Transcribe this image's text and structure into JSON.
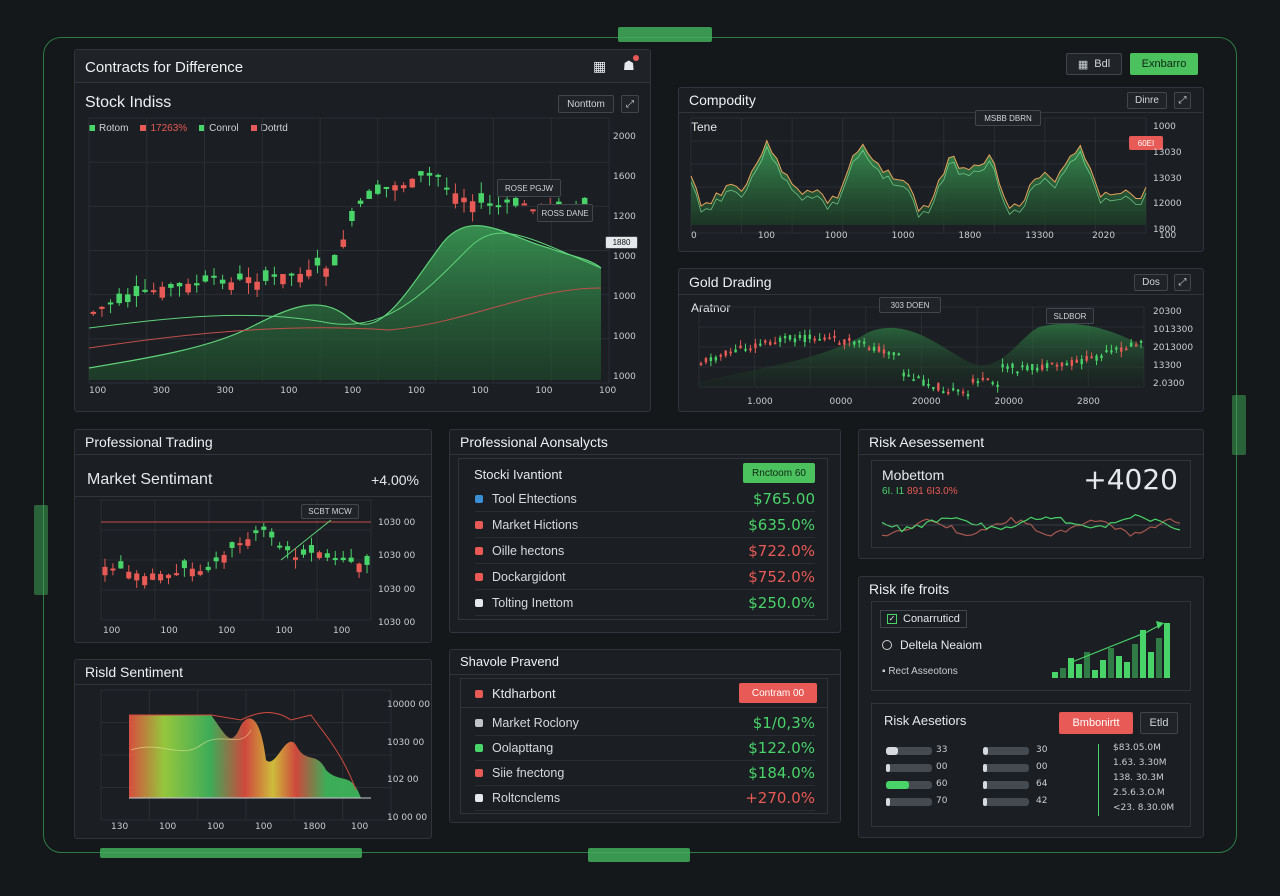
{
  "frame": {
    "accent": "#3fae5a",
    "up": "#49d46a",
    "down": "#e85a55"
  },
  "topright": {
    "btn1": "Bdl",
    "btn2": "Exnbarro"
  },
  "stock_panel": {
    "title": "Contracts for Difference",
    "subtitle": "Stock Indiss",
    "control_label": "Nonttom",
    "legend": [
      {
        "label": "Rotom",
        "color": "#49d46a"
      },
      {
        "label": "17263%",
        "color": "#e85a55"
      },
      {
        "label": "Conrol",
        "color": "#49d46a"
      },
      {
        "label": "Dotrtd",
        "color": "#e85a55"
      }
    ],
    "tag1": "ROSE PGJW",
    "tag2": "ROSS DANE",
    "price_tag": "1880",
    "y_ticks": [
      "2000",
      "1600",
      "1200",
      "1000",
      "1000",
      "1000",
      "1000"
    ],
    "x_ticks": [
      "100",
      "300",
      "300",
      "100",
      "100",
      "100",
      "100",
      "100",
      "100"
    ]
  },
  "commodity_panel": {
    "title": "Compodity",
    "label": "Tene",
    "control_label": "Dinre",
    "tag": "MSBB DBRN",
    "price_tag": "60EI",
    "y_ticks": [
      "1000",
      "13030",
      "13030",
      "12000",
      "1800"
    ],
    "x_ticks": [
      "0",
      "100",
      "1000",
      "1000",
      "1800",
      "13300",
      "2020",
      "100"
    ]
  },
  "gold_panel": {
    "title": "Gold Drading",
    "label": "Aratnor",
    "control_label": "Dos",
    "tag1": "303 DOEN",
    "tag2": "SLDBOR",
    "y_ticks": [
      "20300",
      "1013300",
      "2013000",
      "13300",
      "2.0300"
    ],
    "x_ticks": [
      "1.000",
      "0000",
      "20000",
      "20000",
      "2800"
    ]
  },
  "pro_trading": {
    "title": "Professional Trading",
    "sentiment_label": "Market Sentimant",
    "sentiment_value": "+4.00%",
    "tag": "SCBT MCW",
    "y_ticks": [
      "1030 00",
      "1030 00",
      "1030 00",
      "1030 00"
    ],
    "x_ticks": [
      "100",
      "100",
      "100",
      "100",
      "100"
    ]
  },
  "risk_sentiment": {
    "title": "Risld Sentiment",
    "y_ticks": [
      "10000 00",
      "1030 00",
      "102 00",
      "10 00 00"
    ],
    "x_ticks": [
      "130",
      "100",
      "100",
      "100",
      "1800",
      "100"
    ]
  },
  "pro_assets": {
    "title": "Professional Aonsalycts",
    "header_label": "Stocki Ivantiont",
    "header_button": "Rnctoom 60",
    "rows": [
      {
        "label": "Tool Ehtections",
        "value": "$765.00",
        "trend": "up",
        "icon_color": "#3a8fd6"
      },
      {
        "label": "Market Hictions",
        "value": "$635.0%",
        "trend": "up",
        "icon_color": "#e85a55"
      },
      {
        "label": "Oille hectons",
        "value": "$722.0%",
        "trend": "down",
        "icon_color": "#e85a55"
      },
      {
        "label": "Dockargidont",
        "value": "$752.0%",
        "trend": "down",
        "icon_color": "#e85a55"
      },
      {
        "label": "Tolting Inettom",
        "value": "$250.0%",
        "trend": "up",
        "icon_color": "#e6e9ec"
      }
    ]
  },
  "shavole_panel": {
    "title": "Shavole Pravend",
    "header_label": "Ktdharbont",
    "header_button": "Contram 00",
    "rows": [
      {
        "label": "Market Roclony",
        "value": "$1/0,3%",
        "trend": "up",
        "icon_color": "#c0c4c8"
      },
      {
        "label": "Oolapttang",
        "value": "$122.0%",
        "trend": "up",
        "icon_color": "#49d46a"
      },
      {
        "label": "Siie fnectong",
        "value": "$184.0%",
        "trend": "up",
        "icon_color": "#e85a55"
      },
      {
        "label": "Roltcnclems",
        "value": "+270.0%",
        "trend": "down",
        "icon_color": "#e6e9ec"
      }
    ]
  },
  "risk_assessment": {
    "title": "Risk Aesessement",
    "label": "Mobettom",
    "value": "+4020",
    "sub_green": "6I. I1",
    "sub_red": "891 6I3.0%"
  },
  "risk_profits": {
    "title": "Risk ife froits",
    "item1": "Conarruticd",
    "item2": "Deltela Neaiom",
    "item3": "Rect Asseotons"
  },
  "risk_assessors": {
    "title": "Risk Aesetiors",
    "btn_primary": "Bmbonirtt",
    "btn_secondary": "Etld",
    "bars_left": [
      {
        "fraction": 0.25,
        "value": "33",
        "color": "#8a9097"
      },
      {
        "fraction": 0,
        "value": "00",
        "color": "#8a9097"
      },
      {
        "fraction": 0.5,
        "value": "60",
        "color": "#49d46a"
      },
      {
        "fraction": 0,
        "value": "70",
        "color": "#8a9097"
      }
    ],
    "bars_right": [
      {
        "fraction": 0.1,
        "value": "30",
        "color": "#8a9097"
      },
      {
        "fraction": 0.05,
        "value": "00",
        "color": "#8a9097"
      },
      {
        "fraction": 0,
        "value": "64",
        "color": "#8a9097"
      },
      {
        "fraction": 0,
        "value": "42",
        "color": "#8a9097"
      }
    ],
    "values_list": [
      "$83.05.0M",
      "1.63. 3.30M",
      "138. 30.3M",
      "2.5.6.3.O.M",
      "<23. 8.30.0M"
    ]
  }
}
